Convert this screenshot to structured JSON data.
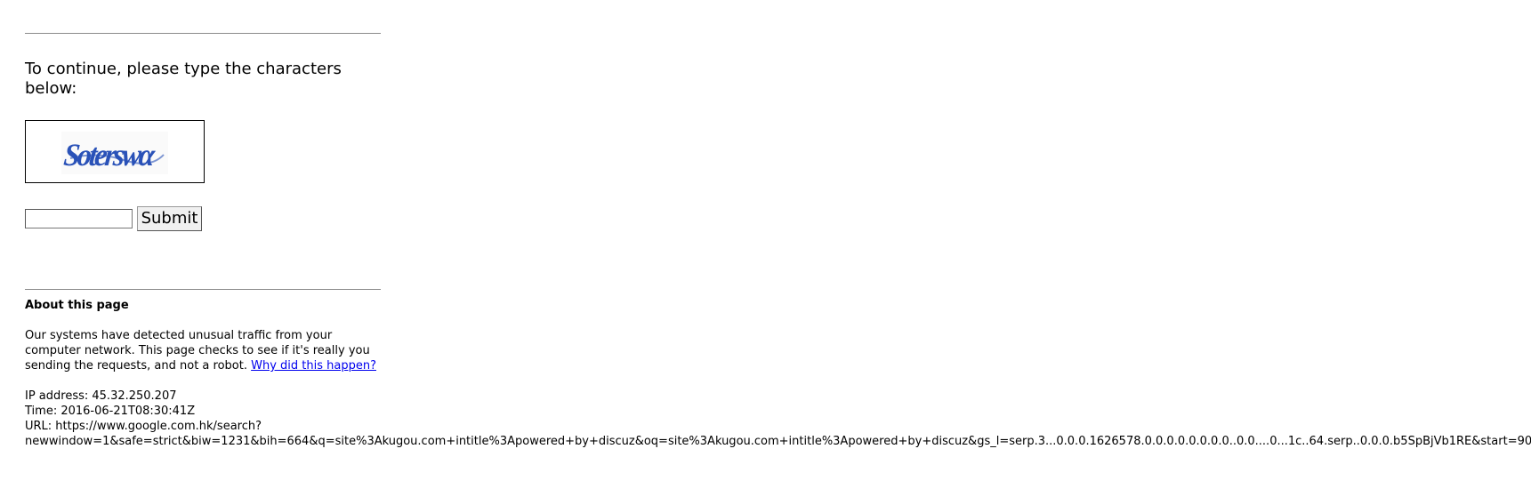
{
  "prompt": "To continue, please type the characters below:",
  "captcha": {
    "image_text": "Soterswα",
    "image_color": "#2a52b8"
  },
  "form": {
    "input_value": "",
    "submit_label": "Submit"
  },
  "about": {
    "title": "About this page",
    "text": "Our systems have detected unusual traffic from your computer network. This page checks to see if it's really you sending the requests, and not a robot.",
    "link_label": "Why did this happen?",
    "link_color": "#0000ee"
  },
  "meta": {
    "ip": "IP address: 45.32.250.207",
    "time": "Time: 2016-06-21T08:30:41Z",
    "url_label": "URL: https://www.google.com.hk/search?",
    "url_rest": "newwindow=1&safe=strict&biw=1231&bih=664&q=site%3Akugou.com+intitle%3Apowered+by+discuz&oq=site%3Akugou.com+intitle%3Apowered+by+discuz&gs_l=serp.3...0.0.0.1626578.0.0.0.0.0.0.0.0..0.0....0...1c..64.serp..0.0.0.b5SpBjVb1RE&start=90"
  }
}
